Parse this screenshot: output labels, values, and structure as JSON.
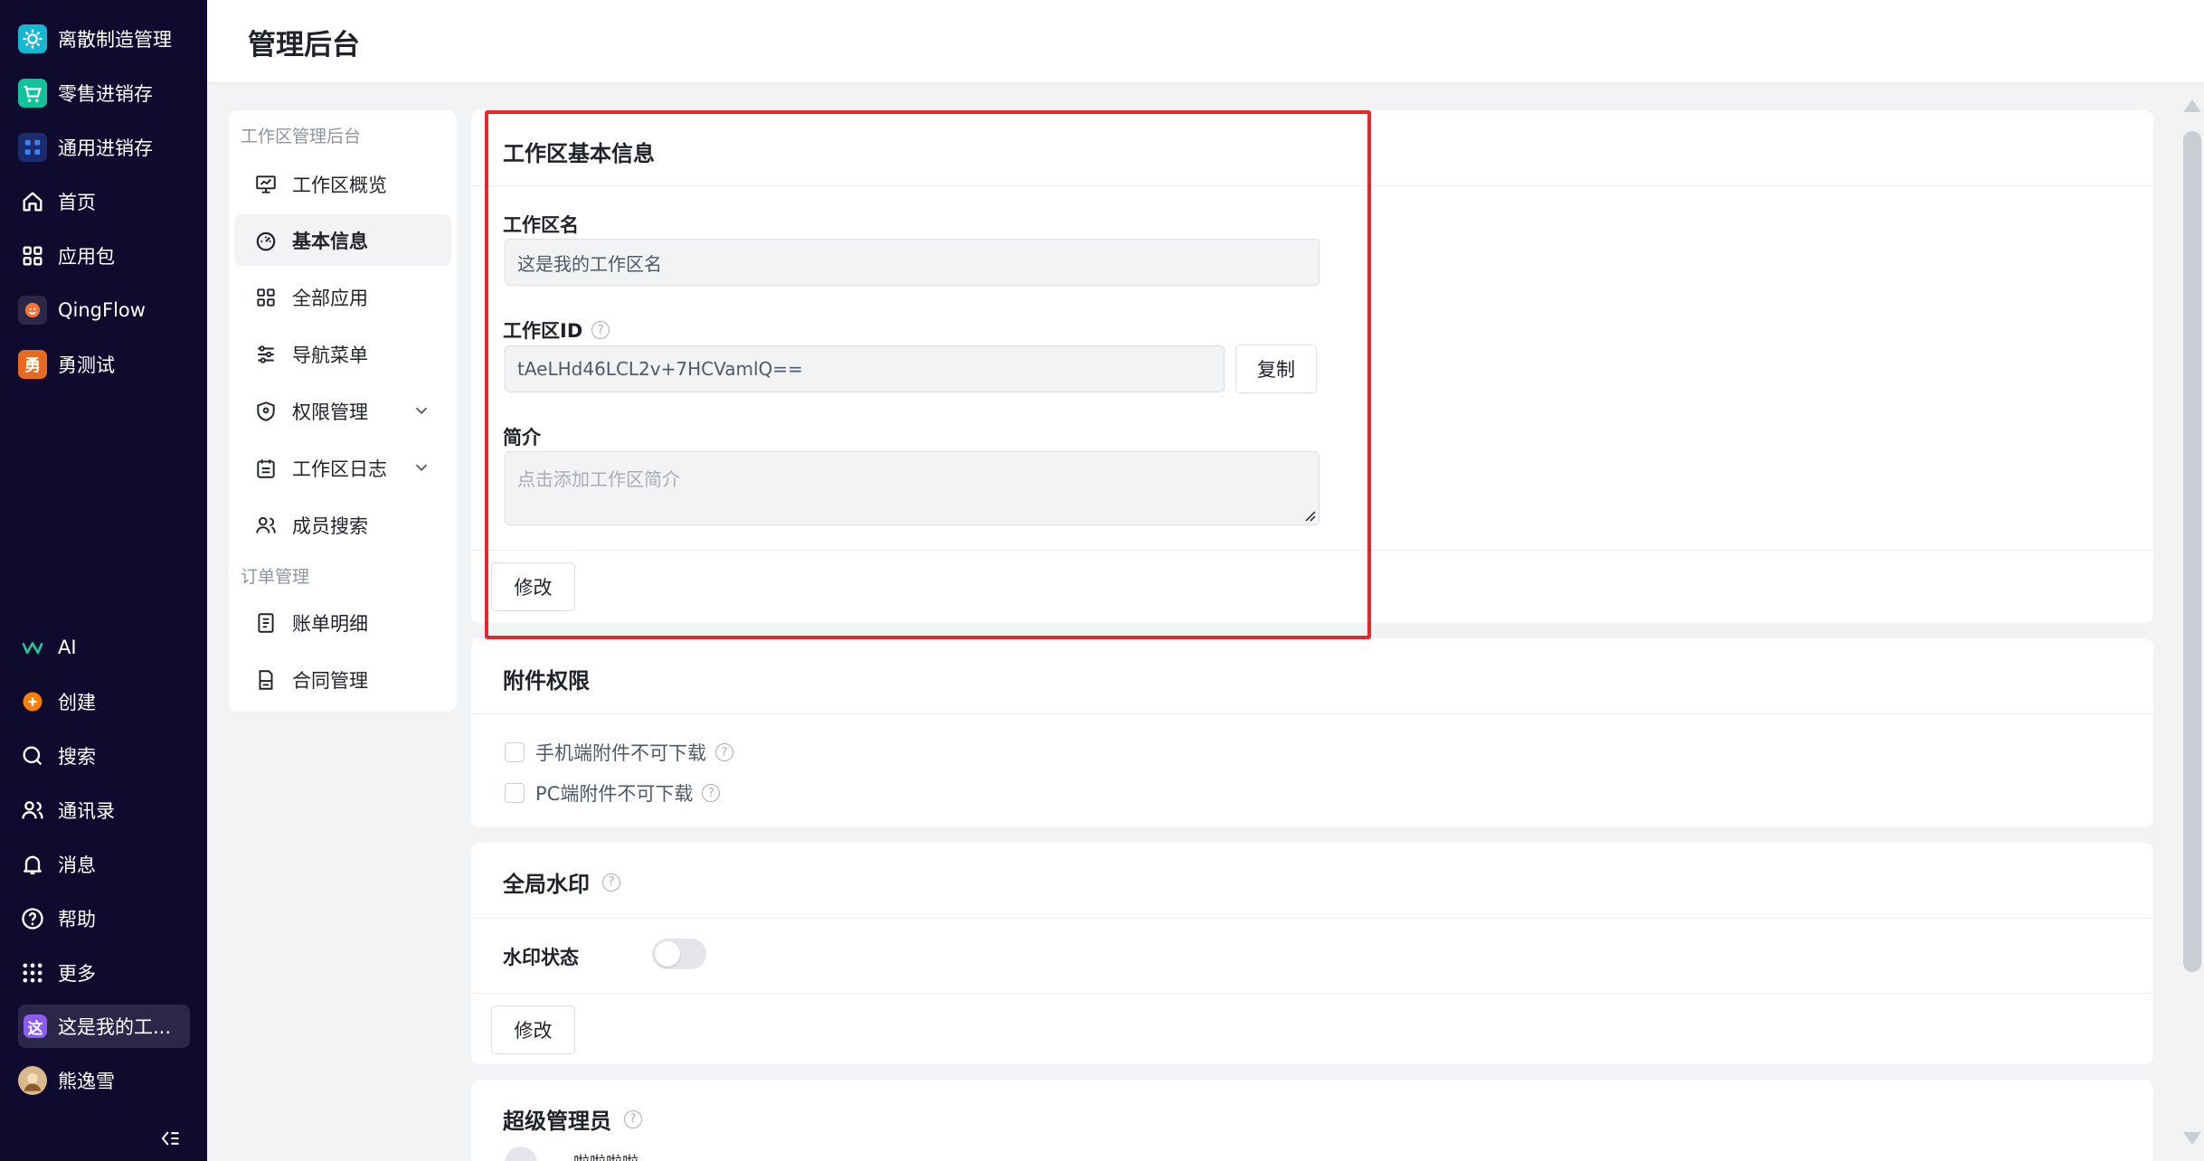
{
  "app_sidebar": {
    "items": [
      {
        "label": "离散制造管理",
        "icon": "gear-app-icon",
        "color": "#14b8d4"
      },
      {
        "label": "零售进销存",
        "icon": "cart-app-icon",
        "color": "#10c39a"
      },
      {
        "label": "通用进销存",
        "icon": "grid-app-icon",
        "color": "#2f6bff"
      },
      {
        "label": "首页",
        "icon": "home-icon"
      },
      {
        "label": "应用包",
        "icon": "apps-icon"
      },
      {
        "label": "QingFlow",
        "icon": "qingflow-app-icon",
        "color": "#f77234"
      },
      {
        "label": "勇测试",
        "icon": "yong-app-icon",
        "color": "#e86a1f",
        "glyph": "勇"
      },
      {
        "label": "AI",
        "icon": "ai-icon",
        "color": "#20c997"
      },
      {
        "label": "创建",
        "icon": "plus-circle-icon",
        "color": "#ff7d00"
      },
      {
        "label": "搜索",
        "icon": "search-icon"
      },
      {
        "label": "通讯录",
        "icon": "contacts-icon"
      },
      {
        "label": "消息",
        "icon": "bell-icon"
      },
      {
        "label": "帮助",
        "icon": "help-icon"
      },
      {
        "label": "更多",
        "icon": "more-grid-icon"
      },
      {
        "label": "这是我的工...",
        "icon": "workspace-icon",
        "color": "#8b5cf6",
        "glyph": "这"
      },
      {
        "label": "熊逸雪",
        "icon": "user-avatar"
      }
    ]
  },
  "header": {
    "title": "管理后台"
  },
  "submenu": {
    "group1": "工作区管理后台",
    "items1": [
      {
        "label": "工作区概览",
        "icon": "monitor-icon"
      },
      {
        "label": "基本信息",
        "icon": "dashboard-icon"
      },
      {
        "label": "全部应用",
        "icon": "apps-icon"
      },
      {
        "label": "导航菜单",
        "icon": "sliders-icon"
      },
      {
        "label": "权限管理",
        "icon": "shield-icon"
      },
      {
        "label": "工作区日志",
        "icon": "calendar-icon"
      },
      {
        "label": "成员搜索",
        "icon": "users-icon"
      }
    ],
    "group2": "订单管理",
    "items2": [
      {
        "label": "账单明细",
        "icon": "bill-icon"
      },
      {
        "label": "合同管理",
        "icon": "contract-icon"
      }
    ]
  },
  "basic_info": {
    "title": "工作区基本信息",
    "name_label": "工作区名",
    "name_value": "这是我的工作区名",
    "id_label": "工作区ID",
    "id_value": "tAeLHd46LCL2v+7HCVamlQ==",
    "copy_button": "复制",
    "intro_label": "简介",
    "intro_placeholder": "点击添加工作区简介",
    "edit_button": "修改"
  },
  "attachment": {
    "title": "附件权限",
    "options": [
      "手机端附件不可下载",
      "PC端附件不可下载"
    ]
  },
  "watermark": {
    "title": "全局水印",
    "status_label": "水印状态",
    "enabled": false,
    "edit_button": "修改"
  },
  "super_admin": {
    "title": "超级管理员",
    "partial_name": "啦啦啦啦"
  },
  "colors": {
    "sidebar_bg": "#0f0b2e",
    "highlight_border": "#e8262b",
    "page_bg": "#f2f3f5"
  }
}
